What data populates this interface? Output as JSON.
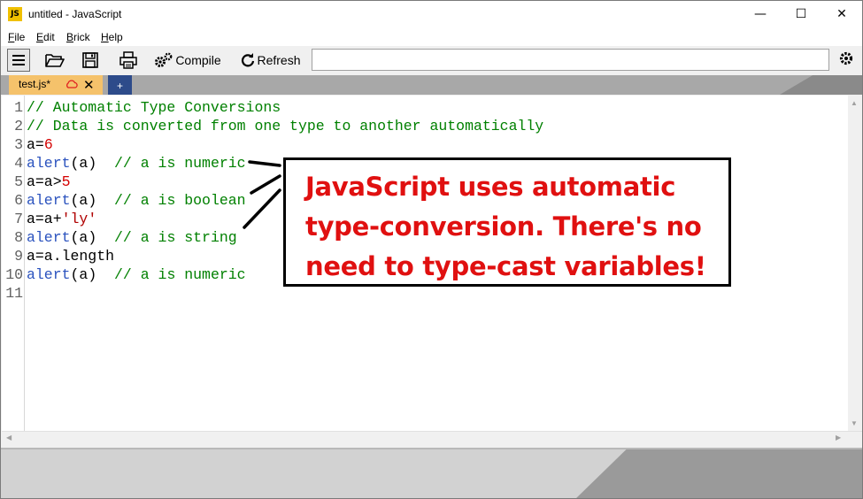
{
  "window": {
    "title": "untitled - JavaScript",
    "app_icon": "JS",
    "controls": {
      "minimize": "—",
      "maximize": "☐",
      "close": "✕"
    }
  },
  "menu": [
    {
      "mnemonic": "F",
      "rest": "ile"
    },
    {
      "mnemonic": "E",
      "rest": "dit"
    },
    {
      "mnemonic": "B",
      "rest": "rick"
    },
    {
      "mnemonic": "H",
      "rest": "elp"
    }
  ],
  "toolbar": {
    "compile_label": "Compile",
    "refresh_label": "Refresh",
    "command_value": ""
  },
  "tabs": {
    "active_label": "test.js*",
    "add_label": "+"
  },
  "editor": {
    "lines": [
      {
        "n": "1",
        "parts": [
          [
            "c-comment",
            "// Automatic Type Conversions"
          ]
        ]
      },
      {
        "n": "2",
        "parts": [
          [
            "c-comment",
            "// Data is converted from one type to another automatically"
          ]
        ]
      },
      {
        "n": "3",
        "parts": [
          [
            "c-ident",
            "a="
          ],
          [
            "c-num",
            "6"
          ]
        ]
      },
      {
        "n": "4",
        "parts": [
          [
            "c-kw",
            "alert"
          ],
          [
            "c-ident",
            "(a)  "
          ],
          [
            "c-comment",
            "// a is numeric"
          ]
        ]
      },
      {
        "n": "5",
        "parts": [
          [
            "c-ident",
            "a=a>"
          ],
          [
            "c-num",
            "5"
          ]
        ]
      },
      {
        "n": "6",
        "parts": [
          [
            "c-kw",
            "alert"
          ],
          [
            "c-ident",
            "(a)  "
          ],
          [
            "c-comment",
            "// a is boolean"
          ]
        ]
      },
      {
        "n": "7",
        "parts": [
          [
            "c-ident",
            "a=a+"
          ],
          [
            "c-str",
            "'ly'"
          ]
        ]
      },
      {
        "n": "8",
        "parts": [
          [
            "c-kw",
            "alert"
          ],
          [
            "c-ident",
            "(a)  "
          ],
          [
            "c-comment",
            "// a is string"
          ]
        ]
      },
      {
        "n": "9",
        "parts": [
          [
            "c-ident",
            "a=a.length"
          ]
        ]
      },
      {
        "n": "10",
        "parts": [
          [
            "c-kw",
            "alert"
          ],
          [
            "c-ident",
            "(a)  "
          ],
          [
            "c-comment",
            "// a is numeric"
          ]
        ]
      },
      {
        "n": "11",
        "parts": []
      }
    ]
  },
  "callout": {
    "text": "JavaScript uses automatic\ntype-conversion.  There's no\nneed to type-cast variables!"
  },
  "colors": {
    "callout_text": "#e01010",
    "comment": "#008000",
    "keyword": "#2a52be",
    "number": "#d40000",
    "tab_active": "#f5c26b",
    "tab_add": "#2d4b8a"
  }
}
